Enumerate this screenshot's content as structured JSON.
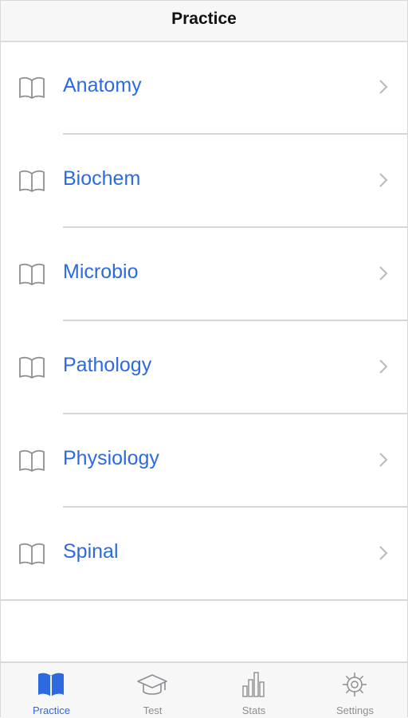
{
  "nav": {
    "title": "Practice"
  },
  "colors": {
    "accent": "#2d6ae0",
    "inactive": "#8e8e93",
    "separator": "#d6d6d6"
  },
  "list": {
    "items": [
      {
        "label": "Anatomy",
        "icon": "book-icon"
      },
      {
        "label": "Biochem",
        "icon": "book-icon"
      },
      {
        "label": "Microbio",
        "icon": "book-icon"
      },
      {
        "label": "Pathology",
        "icon": "book-icon"
      },
      {
        "label": "Physiology",
        "icon": "book-icon"
      },
      {
        "label": "Spinal",
        "icon": "book-icon"
      }
    ]
  },
  "tabbar": {
    "tabs": [
      {
        "label": "Practice",
        "icon": "book-icon",
        "active": true
      },
      {
        "label": "Test",
        "icon": "graduation-cap-icon",
        "active": false
      },
      {
        "label": "Stats",
        "icon": "bar-chart-icon",
        "active": false
      },
      {
        "label": "Settings",
        "icon": "gear-icon",
        "active": false
      }
    ]
  }
}
